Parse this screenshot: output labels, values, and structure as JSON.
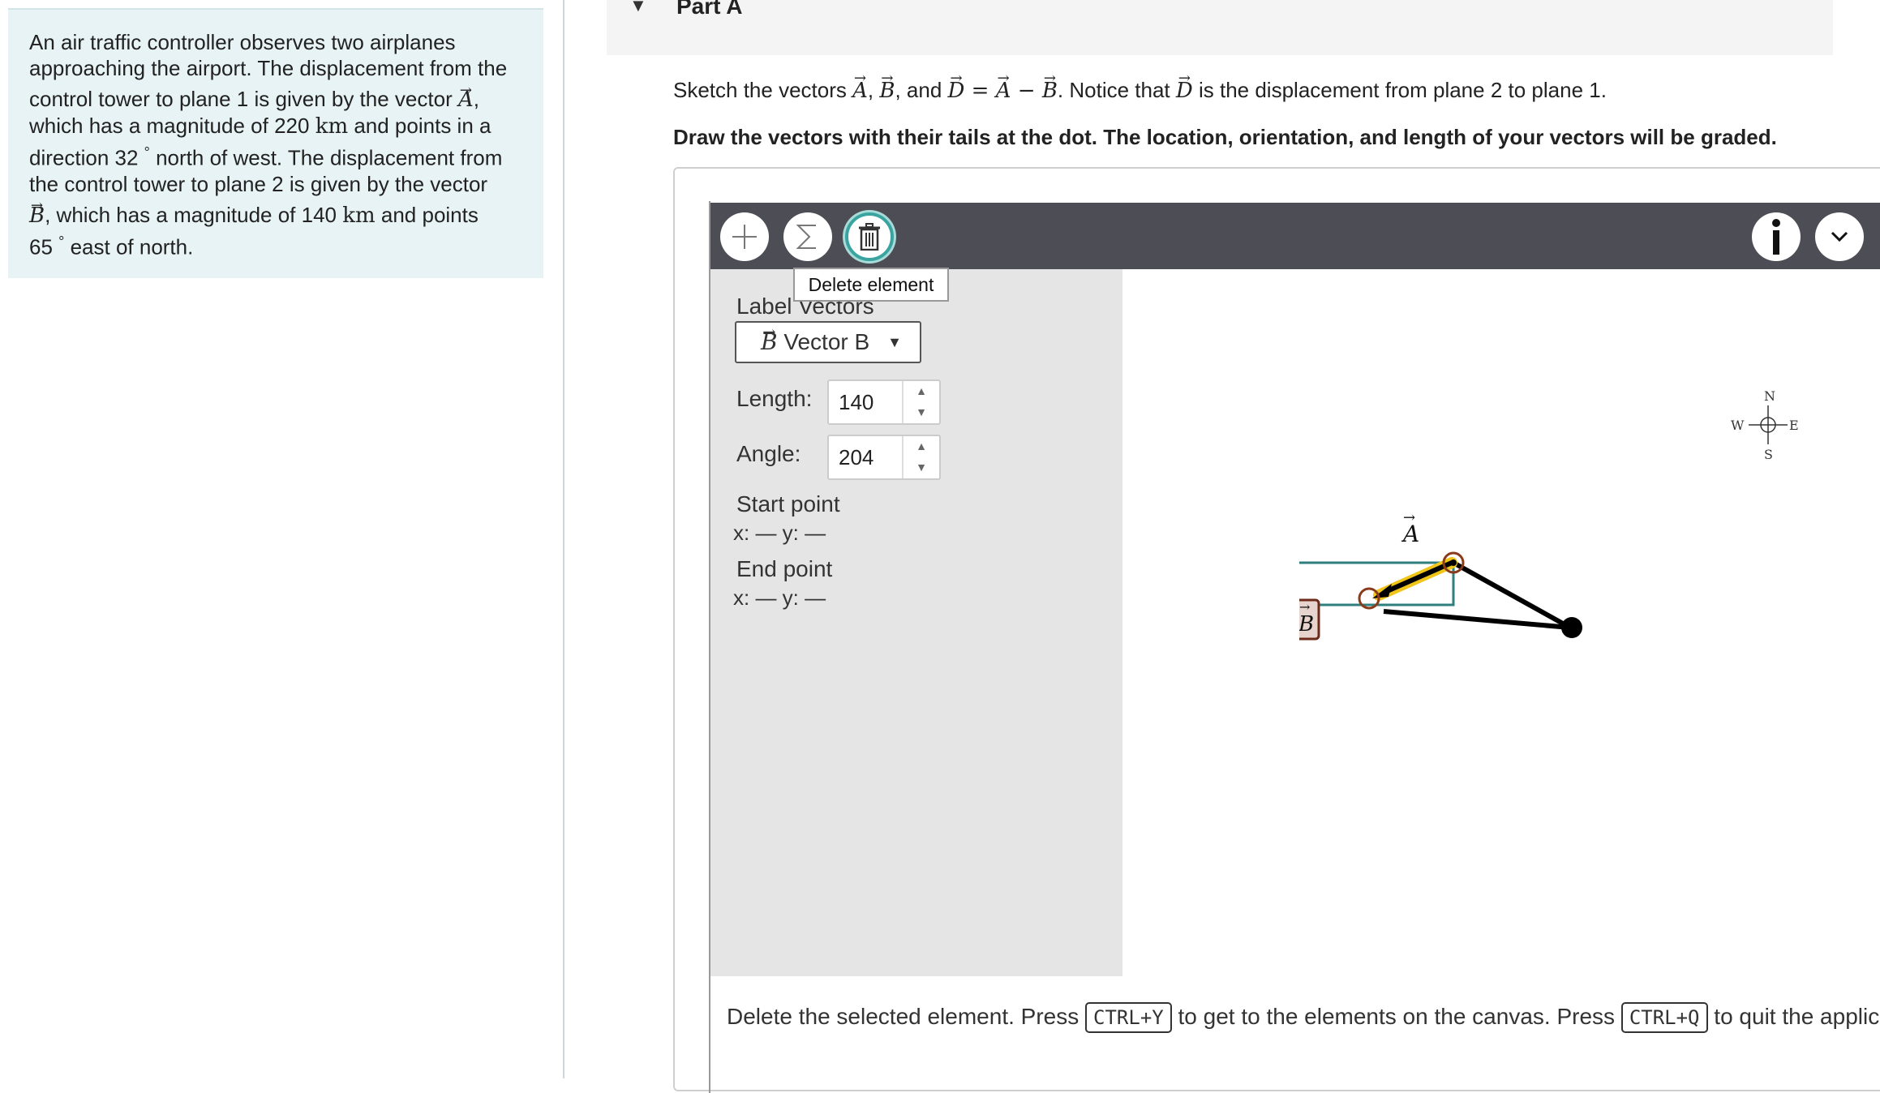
{
  "problem": {
    "line1": "An air traffic controller observes two airplanes",
    "line2": "approaching the airport. The displacement from the",
    "line3a": "control tower to plane 1 is given by the vector ",
    "vecA": "A",
    "line3b": ",",
    "line4a": "which has a magnitude of 220 ",
    "km1": "km",
    "line4b": " and points in a",
    "line5a": "direction 32 ",
    "deg": "°",
    "line5b": " north of west. The displacement from",
    "line6": "the control tower to plane 2 is given by the vector",
    "vecB": "B",
    "line7a": ", which has a magnitude of 140 ",
    "km2": "km",
    "line7b": " and points",
    "line8a": "65 ",
    "line8b": " east of north."
  },
  "part": {
    "title": "Part A"
  },
  "instructions": {
    "t1": "Sketch the vectors ",
    "A": "A",
    "comma1": ", ",
    "B": "B",
    "and": ", and ",
    "D": "D",
    "eq": " = ",
    "A2": "A",
    "minus": " − ",
    "B2": "B",
    "t2": ". Notice that ",
    "D2": "D",
    "t3": " is the displacement from plane 2 to plane 1.",
    "bold": "Draw the vectors with their tails at the dot. The location, orientation, and length of your vectors will be graded."
  },
  "toolbar": {
    "add_icon": "plus-icon",
    "sum_icon": "sigma-icon",
    "delete_icon": "trash-icon",
    "info_icon": "info-icon",
    "menu_icon": "chevron-down-icon",
    "tooltip": "Delete element",
    "accent": "#3aa5a0"
  },
  "panel": {
    "label_vectors": "Label Vectors",
    "dropdown_vec": "B",
    "dropdown_text": " Vector B",
    "length_label": "Length:",
    "length_value": "140",
    "angle_label": "Angle:",
    "angle_value": "204",
    "start_point": "Start point",
    "start_xy": "x: — y: —",
    "end_point": "End point",
    "end_xy": "x: — y: —"
  },
  "canvas": {
    "compass": {
      "n": "N",
      "s": "S",
      "e": "E",
      "w": "W"
    },
    "label_A": "A",
    "label_B": "B"
  },
  "help": {
    "t1": "Delete the selected element. Press ",
    "k1": "CTRL+Y",
    "t2": " to get to the elements on the canvas. Press ",
    "k2": "CTRL+Q",
    "t3": " to quit the applica"
  }
}
